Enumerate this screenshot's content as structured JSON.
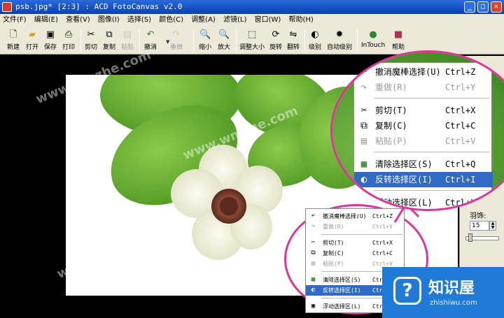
{
  "window": {
    "title": "psb.jpg* [2:3] : ACD FotoCanvas v2.0",
    "min": "_",
    "max": "□",
    "close": "✕"
  },
  "menubar": [
    "文件(F)",
    "编辑(E)",
    "查看(V)",
    "图像(I)",
    "选择(S)",
    "颜色(C)",
    "调整(A)",
    "滤镜(L)",
    "窗口(W)",
    "帮助(H)"
  ],
  "toolbar": {
    "new": "新建",
    "open": "打开",
    "save": "保存",
    "print": "打印",
    "cut": "剪切",
    "copy": "复制",
    "paste": "粘贴",
    "undo": "撤消",
    "redo": "重做",
    "zoom_out": "缩小",
    "zoom_in": "放大",
    "resize": "调整大小",
    "rotate": "旋转",
    "flip": "翻转",
    "levels": "级别",
    "auto_levels": "自动级别",
    "intouch": "InTouch",
    "help": "帮助"
  },
  "context_menu": {
    "items": [
      {
        "label": "撤消魔棒选择(U)",
        "shortcut": "Ctrl+Z",
        "icon": "undo-icon",
        "state": "normal"
      },
      {
        "label": "重做(R)",
        "shortcut": "Ctrl+Y",
        "icon": "redo-icon",
        "state": "disabled"
      },
      {
        "label": "剪切(T)",
        "shortcut": "Ctrl+X",
        "icon": "cut-icon",
        "state": "normal"
      },
      {
        "label": "复制(C)",
        "shortcut": "Ctrl+C",
        "icon": "copy-icon",
        "state": "normal"
      },
      {
        "label": "粘贴(P)",
        "shortcut": "Ctrl+V",
        "icon": "paste-icon",
        "state": "disabled"
      },
      {
        "label": "清除选择区(S)",
        "shortcut": "Ctrl+Q",
        "icon": "clear-selection-icon",
        "state": "normal"
      },
      {
        "label": "反转选择区(I)",
        "shortcut": "Ctrl+I",
        "icon": "invert-selection-icon",
        "state": "highlighted"
      },
      {
        "label": "浮动选择区(L)",
        "shortcut": "Ctrl+L",
        "icon": "float-selection-icon",
        "state": "normal"
      }
    ]
  },
  "side_panel": {
    "feather_label": "羽饰:",
    "feather_value": "15"
  },
  "watermark": "www.wmzhe.com",
  "brand": {
    "name": "知识屋",
    "url": "zhishiwu.com",
    "logo_glyph": "?"
  },
  "colors": {
    "highlight": "#316ac5",
    "callout_ring": "#e0329a",
    "brand_blue": "#1f7bd6"
  }
}
